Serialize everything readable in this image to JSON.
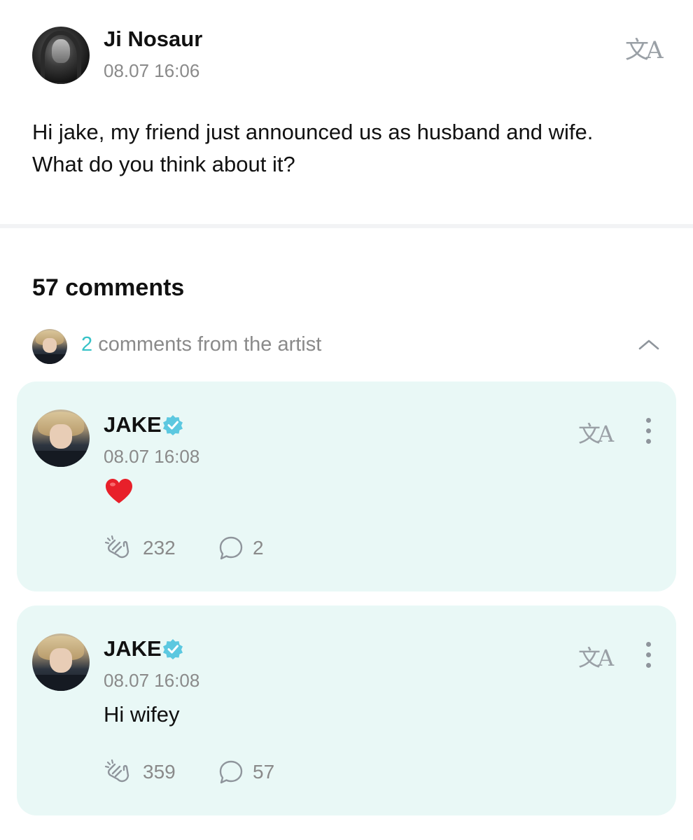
{
  "post": {
    "author": "Ji Nosaur",
    "time": "08.07 16:06",
    "body": "Hi jake, my friend just announced us as husband and wife. What do you think about it?",
    "translate_glyph": "文A"
  },
  "comments_header": {
    "count_label": "57 comments"
  },
  "artist_toggle": {
    "count": "2",
    "label": " comments from the artist"
  },
  "comments": [
    {
      "author": "JAKE",
      "time": "08.07 16:08",
      "body": "",
      "has_heart": true,
      "likes": "232",
      "replies": "2",
      "translate_glyph": "文A"
    },
    {
      "author": "JAKE",
      "time": "08.07 16:08",
      "body": "Hi wifey",
      "has_heart": false,
      "likes": "359",
      "replies": "57",
      "translate_glyph": "文A"
    }
  ],
  "colors": {
    "accent": "#36c2c7",
    "card_bg": "#e9f8f6",
    "muted_text": "#8a8a8a",
    "verified": "#5cc8e0"
  },
  "icons": {
    "translate": "translate-icon",
    "verified": "verified-badge-icon",
    "more": "more-vertical-icon",
    "like": "clap-icon",
    "reply": "comment-bubble-icon",
    "collapse": "chevron-up-icon",
    "heart": "heart-emoji"
  }
}
